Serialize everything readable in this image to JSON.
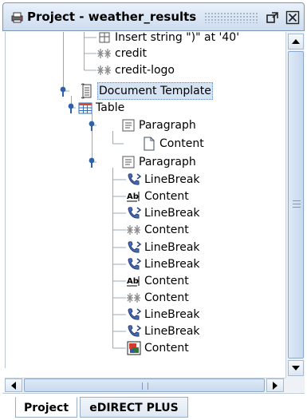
{
  "window": {
    "title": "Project - weather_results",
    "icons": {
      "title": "printer-icon",
      "maximize": "maximize-icon",
      "close": "close-icon"
    }
  },
  "tree": {
    "nodes": [
      {
        "label": "Insert string \")\" at '40'",
        "icon": "field-icon"
      },
      {
        "label": "credit",
        "icon": "sparkle-icon"
      },
      {
        "label": "credit-logo",
        "icon": "sparkle-icon"
      },
      {
        "label": "Document Template",
        "icon": "scroll-icon",
        "selected": true
      },
      {
        "label": "Table",
        "icon": "table-icon"
      },
      {
        "label": "Paragraph",
        "icon": "paragraph-icon"
      },
      {
        "label": "Content",
        "icon": "page-icon"
      },
      {
        "label": "Paragraph",
        "icon": "paragraph-icon"
      },
      {
        "label": "LineBreak",
        "icon": "linebreak-icon"
      },
      {
        "label": "Content",
        "icon": "text-field-icon"
      },
      {
        "label": "LineBreak",
        "icon": "linebreak-icon"
      },
      {
        "label": "Content",
        "icon": "sparkle-icon"
      },
      {
        "label": "LineBreak",
        "icon": "linebreak-icon"
      },
      {
        "label": "LineBreak",
        "icon": "linebreak-icon"
      },
      {
        "label": "Content",
        "icon": "text-field-icon"
      },
      {
        "label": "Content",
        "icon": "sparkle-icon"
      },
      {
        "label": "LineBreak",
        "icon": "linebreak-icon"
      },
      {
        "label": "LineBreak",
        "icon": "linebreak-icon"
      },
      {
        "label": "Content",
        "icon": "image-icon"
      }
    ]
  },
  "tabs": [
    {
      "label": "Project",
      "active": true
    },
    {
      "label": "eDIRECT PLUS",
      "active": false
    }
  ],
  "colors": {
    "selection": "#d6e3f3",
    "titlebar": "#cddcee",
    "lines": "#9aa9ba",
    "accent": "#1f5ca8"
  }
}
